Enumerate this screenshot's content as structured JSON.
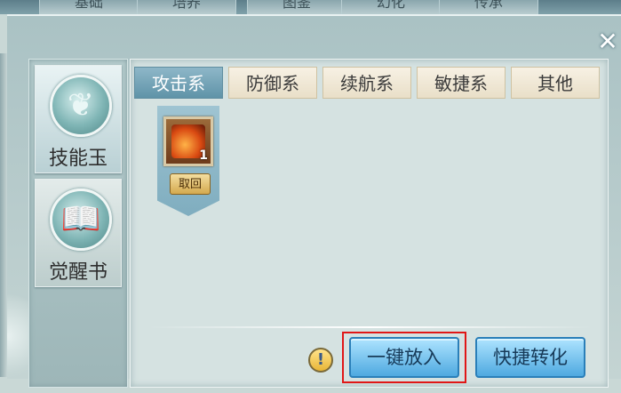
{
  "top_tabs": [
    "基础",
    "培养",
    "图鉴",
    "幻化",
    "传承"
  ],
  "left_categories": [
    {
      "label": "技能玉",
      "icon": "dragon-orb-icon",
      "active": true
    },
    {
      "label": "觉醒书",
      "icon": "book-orb-icon",
      "active": false
    }
  ],
  "tabs": [
    "攻击系",
    "防御系",
    "续航系",
    "敏捷系",
    "其他"
  ],
  "item": {
    "count": "1",
    "icon": "fire-wolf-icon"
  },
  "retrieve_label": "取回",
  "info_label": "!",
  "close_label": "✕",
  "buttons": {
    "one_click": "一键放入",
    "quick_convert": "快捷转化"
  },
  "colors": {
    "active_tab": "#5f93a8",
    "action_button": "#4ea9e0",
    "highlight": "#e01717"
  }
}
